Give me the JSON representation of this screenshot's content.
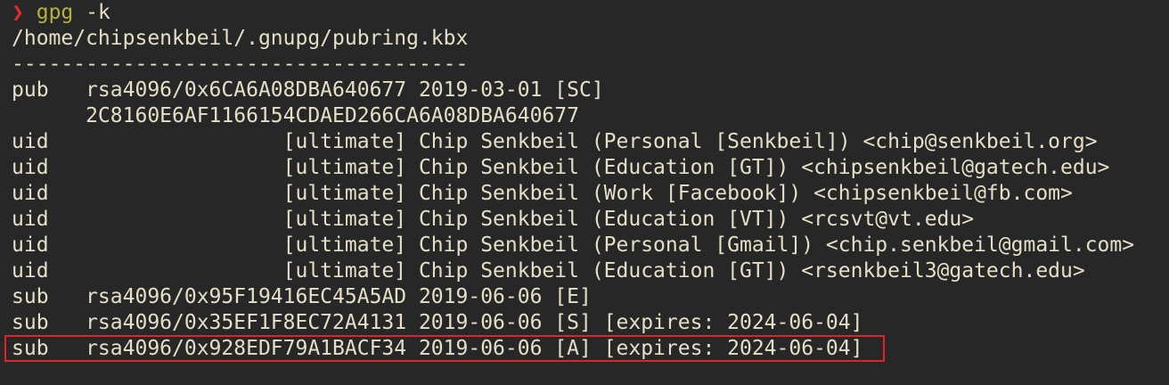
{
  "prompt": {
    "symbol": "❯",
    "command": "gpg",
    "args": " -k"
  },
  "keyring_path": "/home/chipsenkbeil/.gnupg/pubring.kbx",
  "separator": "-------------------------------------",
  "pub": {
    "line": "pub   rsa4096/0x6CA6A08DBA640677 2019-03-01 [SC]",
    "fingerprint": "      2C8160E6AF1166154CDAED266CA6A08DBA640677"
  },
  "uids": [
    "uid                   [ultimate] Chip Senkbeil (Personal [Senkbeil]) <chip@senkbeil.org>",
    "uid                   [ultimate] Chip Senkbeil (Education [GT]) <chipsenkbeil@gatech.edu>",
    "uid                   [ultimate] Chip Senkbeil (Work [Facebook]) <chipsenkbeil@fb.com>",
    "uid                   [ultimate] Chip Senkbeil (Education [VT]) <rcsvt@vt.edu>",
    "uid                   [ultimate] Chip Senkbeil (Personal [Gmail]) <chip.senkbeil@gmail.com>",
    "uid                   [ultimate] Chip Senkbeil (Education [GT]) <rsenkbeil3@gatech.edu>"
  ],
  "subs": [
    "sub   rsa4096/0x95F19416EC45A5AD 2019-06-06 [E]",
    "sub   rsa4096/0x35EF1F8EC72A4131 2019-06-06 [S] [expires: 2024-06-04]",
    "sub   rsa4096/0x928EDF79A1BACF34 2019-06-06 [A] [expires: 2024-06-04]"
  ],
  "colors": {
    "background": "#272727",
    "foreground": "#e6dfc7",
    "prompt_symbol": "#dd2d2d",
    "command": "#b3b23d",
    "highlight_border": "#d8262a"
  }
}
